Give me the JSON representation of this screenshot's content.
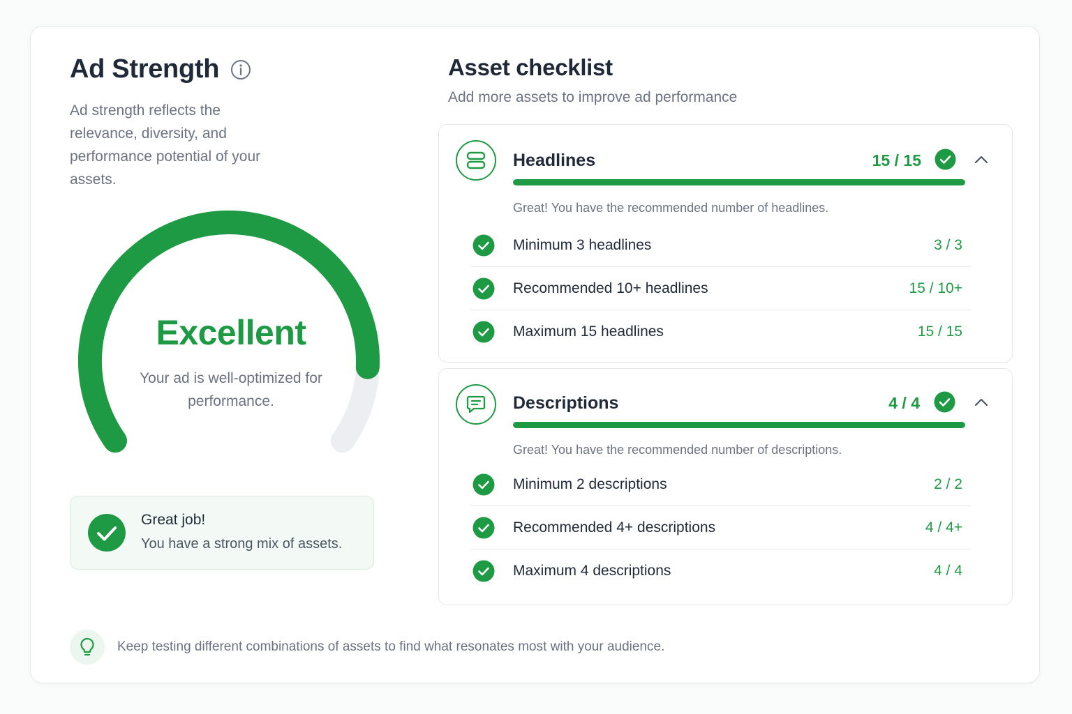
{
  "ad_strength": {
    "title": "Ad Strength",
    "info_icon": "info-circle-icon",
    "description": "Ad strength reflects the relevance, diversity, and performance potential of your assets.",
    "rating": "Excellent",
    "rating_subtitle": "Your ad is well-optimized for performance.",
    "gauge_level": 0.87,
    "great_job": {
      "title": "Great job!",
      "subtitle": "You have a strong mix of assets."
    }
  },
  "checklist": {
    "title": "Asset checklist",
    "subtitle": "Add more assets to improve ad performance",
    "sections": [
      {
        "title": "Headlines",
        "icon": "headlines-icon",
        "count": "15 / 15",
        "progress": 1.0,
        "message": "Great! You have the recommended number of headlines.",
        "rows": [
          {
            "label": "Minimum 3 headlines",
            "value": "3 / 3"
          },
          {
            "label": "Recommended 10+ headlines",
            "value": "15 / 10+"
          },
          {
            "label": "Maximum 15 headlines",
            "value": "15 / 15"
          }
        ]
      },
      {
        "title": "Descriptions",
        "icon": "chat-message-icon",
        "count": "4 / 4",
        "progress": 1.0,
        "message": "Great! You have the recommended number of descriptions.",
        "rows": [
          {
            "label": "Minimum 2 descriptions",
            "value": "2 / 2"
          },
          {
            "label": "Recommended 4+ descriptions",
            "value": "4 / 4+"
          },
          {
            "label": "Maximum 4 descriptions",
            "value": "4 / 4"
          }
        ]
      }
    ]
  },
  "tip": {
    "icon": "lightbulb-icon",
    "text": "Keep testing different combinations of assets to find what resonates most with your audience."
  },
  "colors": {
    "accent": "#1e9a45",
    "track": "#eceef1",
    "text": "#1f2937",
    "muted": "#6b7280"
  }
}
